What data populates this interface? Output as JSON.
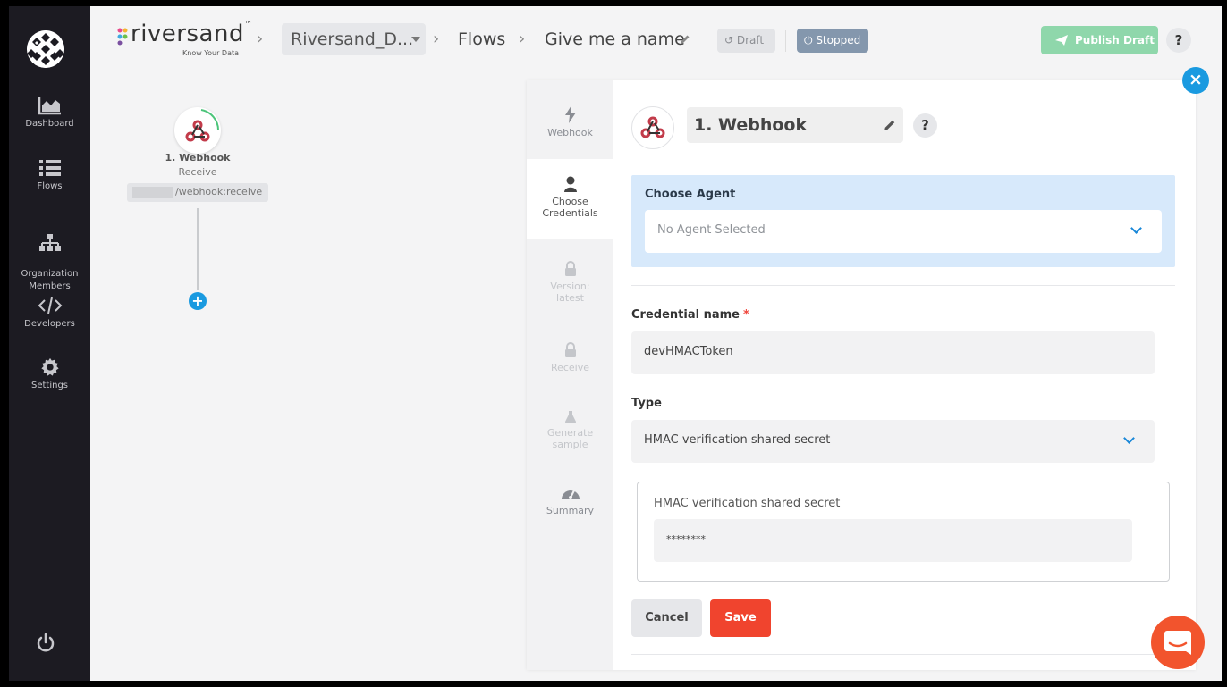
{
  "sidebar": {
    "items": [
      {
        "label": "Dashboard",
        "icon": "dashboard-icon"
      },
      {
        "label": "Flows",
        "icon": "flows-icon"
      },
      {
        "label": "Organization\nMembers",
        "icon": "org-members-icon"
      },
      {
        "label": "Developers",
        "icon": "code-icon"
      },
      {
        "label": "Settings",
        "icon": "gear-icon"
      }
    ],
    "power_icon": "power-icon"
  },
  "header": {
    "brand_name": "riversand",
    "brand_tm": "™",
    "brand_tagline": "Know Your Data",
    "workspace_select": "Riversand_D...",
    "crumb_flows": "Flows",
    "flow_name": "Give me a name",
    "draft_label": "Draft",
    "stopped_label": "Stopped",
    "publish_label": "Publish Draft",
    "help_label": "?"
  },
  "canvas": {
    "node_title": "1. Webhook",
    "node_subtitle": "Receive",
    "node_url": "/webhook:receive"
  },
  "panel": {
    "steps": [
      {
        "label": "Webhook",
        "icon": "bolt-icon",
        "state": "normal"
      },
      {
        "label": "Choose Credentials",
        "icon": "user-icon",
        "state": "active"
      },
      {
        "label": "Version: latest",
        "icon": "lock-icon",
        "state": "disabled"
      },
      {
        "label": "Receive",
        "icon": "lock-icon",
        "state": "disabled"
      },
      {
        "label": "Generate sample",
        "icon": "flask-icon",
        "state": "disabled"
      },
      {
        "label": "Summary",
        "icon": "gauge-icon",
        "state": "normal"
      }
    ],
    "title": "1. Webhook",
    "help_label": "?",
    "choose_agent_label": "Choose Agent",
    "agent_placeholder": "No Agent Selected",
    "credential_name_label": "Credential name",
    "required_mark": "*",
    "credential_name_value": "devHMACToken",
    "type_label": "Type",
    "type_value": "HMAC verification shared secret",
    "secret_label": "HMAC verification shared secret",
    "secret_value": "********",
    "cancel_label": "Cancel",
    "save_label": "Save",
    "close_label": "×"
  },
  "colors": {
    "sidebar_bg": "#1c1b22",
    "accent_blue": "#1a9ae0",
    "publish_green": "#8fd7ab",
    "save_red": "#f0442e",
    "agent_box_bg": "#d7e9fb",
    "stopped_bg": "#8497ad"
  }
}
